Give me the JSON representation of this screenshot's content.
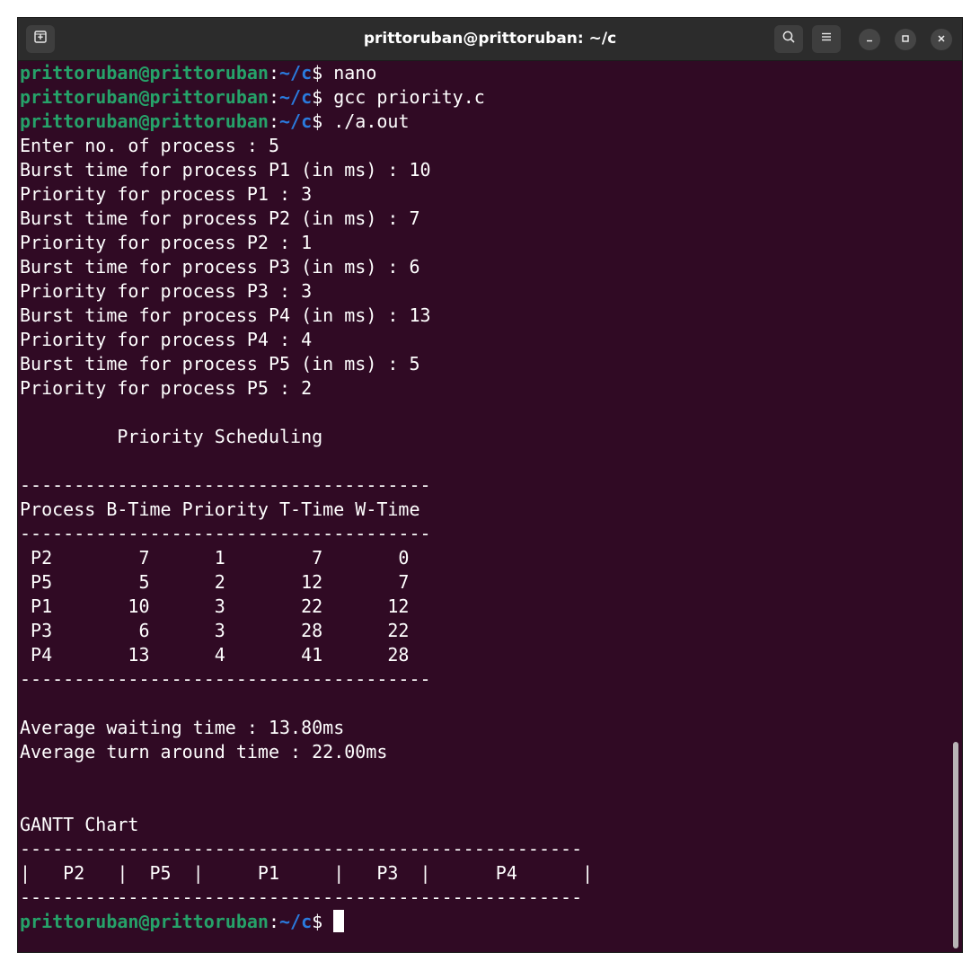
{
  "window": {
    "title": "prittoruban@prittoruban: ~/c"
  },
  "prompt": {
    "user_host": "prittoruban@prittoruban",
    "sep": ":",
    "path": "~/c",
    "dollar": "$ "
  },
  "commands": [
    "nano",
    "gcc priority.c",
    "./a.out"
  ],
  "output": [
    "Enter no. of process : 5",
    "Burst time for process P1 (in ms) : 10",
    "Priority for process P1 : 3",
    "Burst time for process P2 (in ms) : 7",
    "Priority for process P2 : 1",
    "Burst time for process P3 (in ms) : 6",
    "Priority for process P3 : 3",
    "Burst time for process P4 (in ms) : 13",
    "Priority for process P4 : 4",
    "Burst time for process P5 (in ms) : 5",
    "Priority for process P5 : 2",
    "",
    "         Priority Scheduling",
    "",
    "--------------------------------------",
    "Process B-Time Priority T-Time W-Time",
    "--------------------------------------",
    " P2        7      1        7       0",
    " P5        5      2       12       7",
    " P1       10      3       22      12",
    " P3        6      3       28      22",
    " P4       13      4       41      28",
    "--------------------------------------",
    "",
    "Average waiting time : 13.80ms",
    "Average turn around time : 22.00ms",
    "",
    "",
    "GANTT Chart",
    "----------------------------------------------------",
    "|   P2   |  P5  |     P1     |   P3  |      P4      |",
    "----------------------------------------------------"
  ],
  "icons": {
    "new_tab": "new-tab-icon",
    "search": "search-icon",
    "menu": "hamburger-menu-icon",
    "minimize": "minimize-icon",
    "maximize": "maximize-icon",
    "close": "close-icon"
  },
  "colors": {
    "background": "#300a24",
    "prompt_user": "#26a269",
    "prompt_path": "#2a7bde",
    "text": "#ffffff"
  }
}
